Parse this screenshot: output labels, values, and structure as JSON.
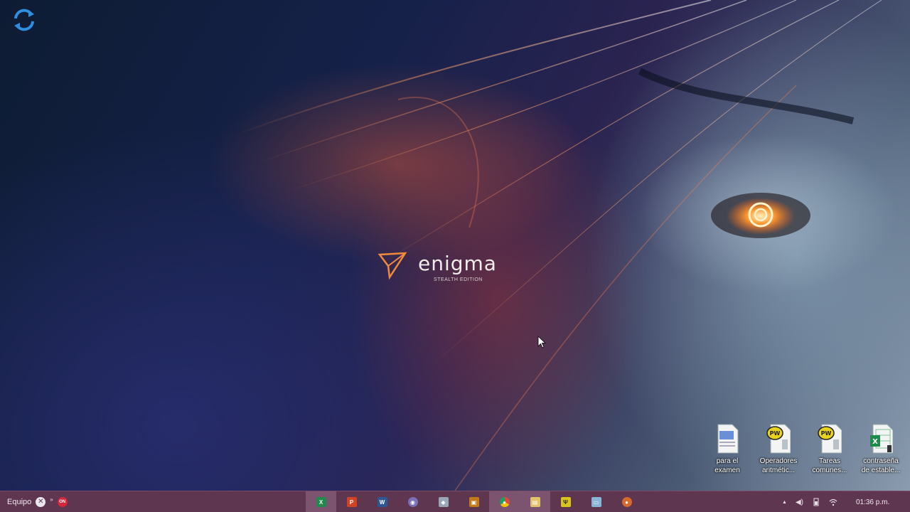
{
  "wallpaper": {
    "logo_word": "enigma",
    "logo_subtitle": "STEALTH EDITION",
    "accent_color": "#f08a3c"
  },
  "desktop_icons": [
    {
      "label_line1": "para el",
      "label_line2": "examen",
      "icon": "word-document-icon",
      "accent": "#6b8fd6"
    },
    {
      "label_line1": "Operadores",
      "label_line2": "aritmétic...",
      "icon": "pseint-file-icon",
      "accent": "#e8d21e"
    },
    {
      "label_line1": "Tareas",
      "label_line2": "comunes...",
      "icon": "pseint-file-icon",
      "accent": "#e8d21e"
    },
    {
      "label_line1": "contraseña",
      "label_line2": "de estable...",
      "icon": "excel-file-icon",
      "accent": "#1f8a4c"
    }
  ],
  "taskbar": {
    "start_label": "Equipo",
    "badge_glyph": "✕",
    "chevron": "»",
    "red_badge_text": "ON",
    "apps": [
      {
        "name": "excel-app",
        "glyph": "X",
        "color": "#1f8a4c",
        "active": true
      },
      {
        "name": "powerpoint-app",
        "glyph": "P",
        "color": "#d04423",
        "active": false
      },
      {
        "name": "word-app",
        "glyph": "W",
        "color": "#2b5797",
        "active": false
      },
      {
        "name": "globe-app",
        "glyph": "◉",
        "color": "#7a6fb8",
        "active": false
      },
      {
        "name": "network-app",
        "glyph": "◆",
        "color": "#9aa7b8",
        "active": false
      },
      {
        "name": "presentation-app",
        "glyph": "▣",
        "color": "#c27a1a",
        "active": false
      },
      {
        "name": "chrome-app",
        "glyph": "●",
        "color": "#dd4b39",
        "active": true
      },
      {
        "name": "file-explorer-app",
        "glyph": "▤",
        "color": "#e2c26a",
        "active": true
      },
      {
        "name": "pseint-app",
        "glyph": "Ψ",
        "color": "#d9c21a",
        "active": false
      },
      {
        "name": "monitor-app",
        "glyph": "▭",
        "color": "#8ab4d8",
        "active": false
      },
      {
        "name": "fox-app",
        "glyph": "●",
        "color": "#d76a2a",
        "active": false
      }
    ]
  },
  "tray": {
    "overflow": "▲",
    "volume": "◀)",
    "clock": "01:36 p.m."
  }
}
